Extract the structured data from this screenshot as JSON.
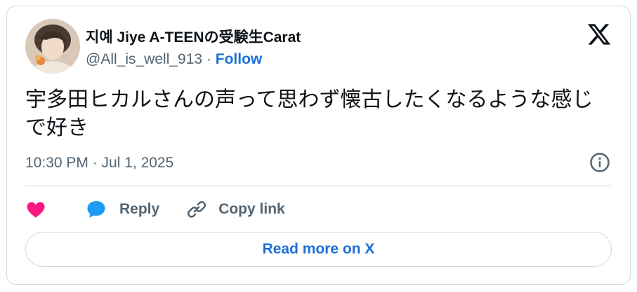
{
  "author": {
    "display_name": "지예 Jiye A-TEENの受験生Carat",
    "handle": "@All_is_well_913",
    "separator": "·",
    "follow_label": "Follow"
  },
  "tweet": {
    "text": "宇多田ヒカルさんの声って思わず懐古したくなるような感じで好き",
    "timestamp": "10:30 PM · Jul 1, 2025"
  },
  "actions": {
    "like_icon": "heart-icon",
    "reply_label": "Reply",
    "reply_icon": "speech-bubble-icon",
    "copy_link_label": "Copy link",
    "copy_link_icon": "chain-link-icon"
  },
  "footer": {
    "read_more_label": "Read more on X"
  },
  "colors": {
    "like": "#f91880",
    "reply": "#1d9bf0",
    "link": "#1d6fd8",
    "secondary_text": "#536471",
    "primary_text": "#0f1419",
    "border": "#cfd9de"
  },
  "icons": {
    "brand": "x-logo-icon",
    "info": "info-icon"
  }
}
